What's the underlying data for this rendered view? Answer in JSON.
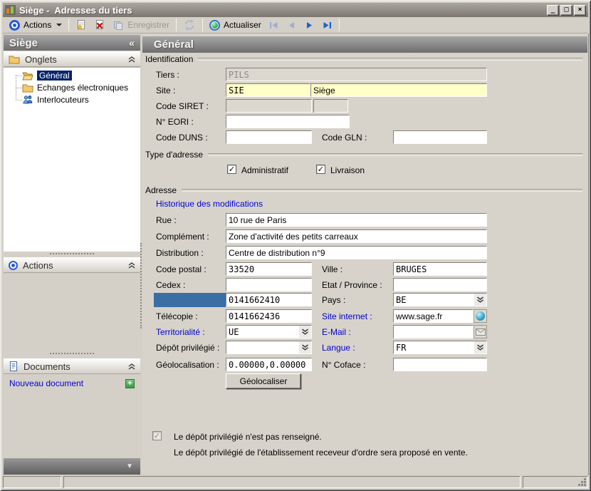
{
  "icons": {
    "minimize": "_",
    "maximize": "□",
    "close": "×",
    "collapse_left": "«",
    "chevron_down": "▼",
    "check": "✓",
    "plus": "+"
  },
  "titlebar": {
    "title": "Siège -  Adresses du tiers"
  },
  "toolbar": {
    "actions_label": "Actions",
    "enregistrer_label": "Enregistrer",
    "actualiser_label": "Actualiser"
  },
  "sidebar": {
    "title": "Siège",
    "sections": {
      "onglets": "Onglets",
      "actions": "Actions",
      "documents": "Documents"
    },
    "tree": [
      {
        "label": "Général",
        "selected": true
      },
      {
        "label": "Echanges électroniques",
        "selected": false
      },
      {
        "label": "Interlocuteurs",
        "selected": false
      }
    ],
    "nouveau_document": "Nouveau document"
  },
  "main": {
    "header": "Général",
    "groups": {
      "identification": "Identification",
      "type_adresse": "Type d'adresse",
      "adresse": "Adresse"
    },
    "identification": {
      "tiers": {
        "label": "Tiers :",
        "value": "PILS"
      },
      "site": {
        "label": "Site :",
        "code": "SIE",
        "name": "Siège"
      },
      "siret": {
        "label": "Code SIRET :",
        "value1": "",
        "value2": ""
      },
      "eori": {
        "label": "N° EORI :",
        "value": ""
      },
      "duns": {
        "label": "Code DUNS :",
        "value": ""
      },
      "gln": {
        "label": "Code GLN :",
        "value": ""
      }
    },
    "type_adresse": {
      "administratif_label": "Administratif",
      "livraison_label": "Livraison",
      "administratif_checked": true,
      "livraison_checked": true
    },
    "adresse": {
      "historique_link": "Historique des modifications",
      "rue": {
        "label": "Rue :",
        "value": "10 rue de Paris"
      },
      "complement": {
        "label": "Complément :",
        "value": "Zone d'activité des petits carreaux"
      },
      "distribution": {
        "label": "Distribution :",
        "value": "Centre de distribution n°9"
      },
      "code_postal": {
        "label": "Code postal :",
        "value": "33520"
      },
      "ville": {
        "label": "Ville :",
        "value": "BRUGES"
      },
      "cedex": {
        "label": "Cedex :",
        "value": ""
      },
      "etat_province": {
        "label": "Etat / Province :",
        "value": ""
      },
      "telephone": {
        "value": "0141662410"
      },
      "pays": {
        "label": "Pays :",
        "value": "BE"
      },
      "telecopie": {
        "label": "Télécopie :",
        "value": "0141662436"
      },
      "site_internet": {
        "label": "Site internet :",
        "value": "www.sage.fr"
      },
      "territorialite": {
        "label": "Territorialité :",
        "value": "UE"
      },
      "email": {
        "label": "E-Mail :",
        "value": ""
      },
      "depot_privilegie": {
        "label": "Dépôt privilégié :",
        "value": ""
      },
      "langue": {
        "label": "Langue :",
        "value": "FR"
      },
      "geolocalisation": {
        "label": "Géolocalisation :",
        "value": "0.00000,0.00000"
      },
      "coface": {
        "label": "N° Coface :",
        "value": ""
      },
      "geolocaliser_button": "Géolocaliser"
    },
    "footer": {
      "line1": "Le dépôt privilégié n'est pas renseigné.",
      "line2": "Le dépôt privilégié de l'établissement receveur d'ordre sera proposé en vente."
    }
  },
  "colors": {
    "input_highlight_yellow": "#ffffc8",
    "tree_selection_navy": "#0a246a",
    "selected_label_blue": "#3a6ea5",
    "link_blue": "#0000cc",
    "panel_background": "#d7d3cb"
  }
}
